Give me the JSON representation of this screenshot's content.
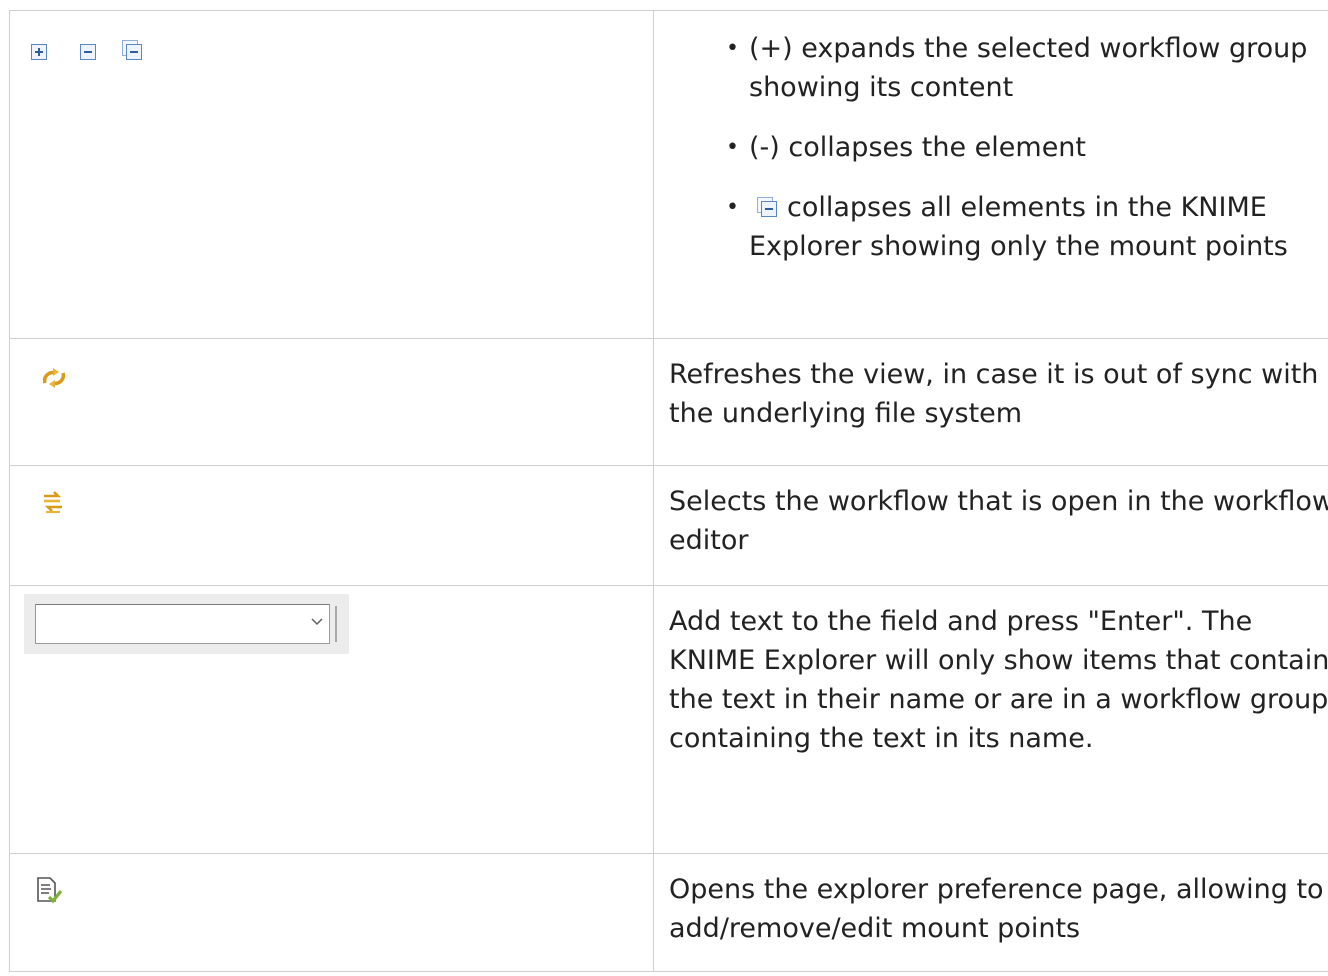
{
  "rows": [
    {
      "icons": [
        "expand-icon",
        "collapse-icon",
        "collapse-all-icon"
      ],
      "bullets": [
        {
          "text": "(+) expands the selected workflow group showing its content"
        },
        {
          "text": "(-) collapses the element"
        },
        {
          "icon": "collapse-all-icon",
          "text": "collapses all elements in the KNIME Explorer showing only the mount points"
        }
      ]
    },
    {
      "icons": [
        "refresh-icon"
      ],
      "description": "Refreshes the view, in case it is out of sync with the underlying file system"
    },
    {
      "icons": [
        "link-with-editor-icon"
      ],
      "description": "Selects the workflow that is open in the workflow editor"
    },
    {
      "icons": [
        "filter-combo"
      ],
      "filter": {
        "value": ""
      },
      "description": "Add text to the field and press \"Enter\". The KNIME Explorer will only show items that contain the text in their name or are in a workflow group containing the text in its name."
    },
    {
      "icons": [
        "preferences-icon"
      ],
      "description": "Opens the explorer preference page, allowing to add/remove/edit mount points"
    }
  ],
  "colors": {
    "border": "#cfcfcf",
    "icon_blue": "#5b86c3",
    "icon_orange": "#e0a020",
    "icon_green": "#7bb33a"
  }
}
